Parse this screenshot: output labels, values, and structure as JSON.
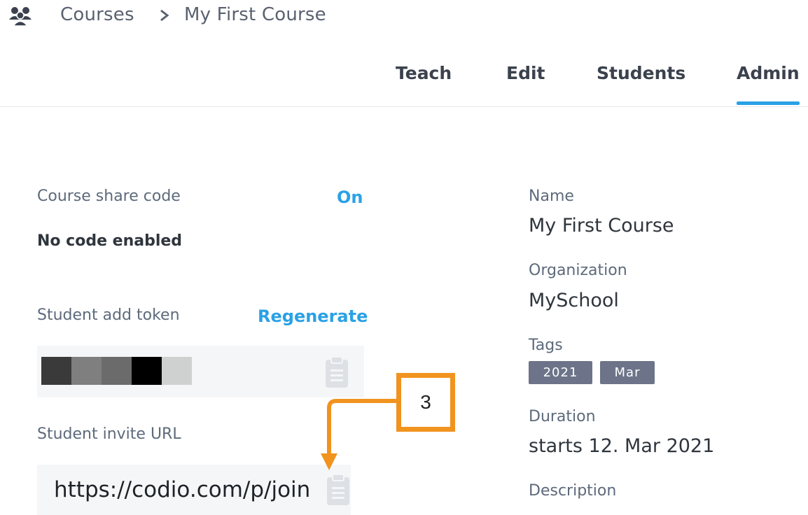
{
  "breadcrumb": {
    "icon": "users-icon",
    "root": "Courses",
    "current": "My First Course"
  },
  "tabs": [
    {
      "label": "Teach",
      "active": false
    },
    {
      "label": "Edit",
      "active": false
    },
    {
      "label": "Students",
      "active": false
    },
    {
      "label": "Admin",
      "active": true
    }
  ],
  "share": {
    "label": "Course share code",
    "toggle": "On",
    "status": "No code enabled"
  },
  "token": {
    "label": "Student add token",
    "action": "Regenerate",
    "copy_icon": "clipboard-icon",
    "masked_colors": [
      "#3a3a3a",
      "#7f7f7f",
      "#6b6b6b",
      "#000000",
      "#cfd0d0"
    ]
  },
  "invite": {
    "label": "Student invite URL",
    "url": "https://codio.com/p/join",
    "copy_icon": "clipboard-icon"
  },
  "details": {
    "name_label": "Name",
    "name_value": "My First Course",
    "org_label": "Organization",
    "org_value": "MySchool",
    "tags_label": "Tags",
    "tags": [
      "2021",
      "Mar"
    ],
    "duration_label": "Duration",
    "duration_value": "starts 12. Mar 2021",
    "description_label": "Description"
  },
  "annotation": {
    "number": "3"
  },
  "colors": {
    "accent": "#2aa1e6",
    "callout": "#f1931f",
    "tag_bg": "#6d7489"
  }
}
